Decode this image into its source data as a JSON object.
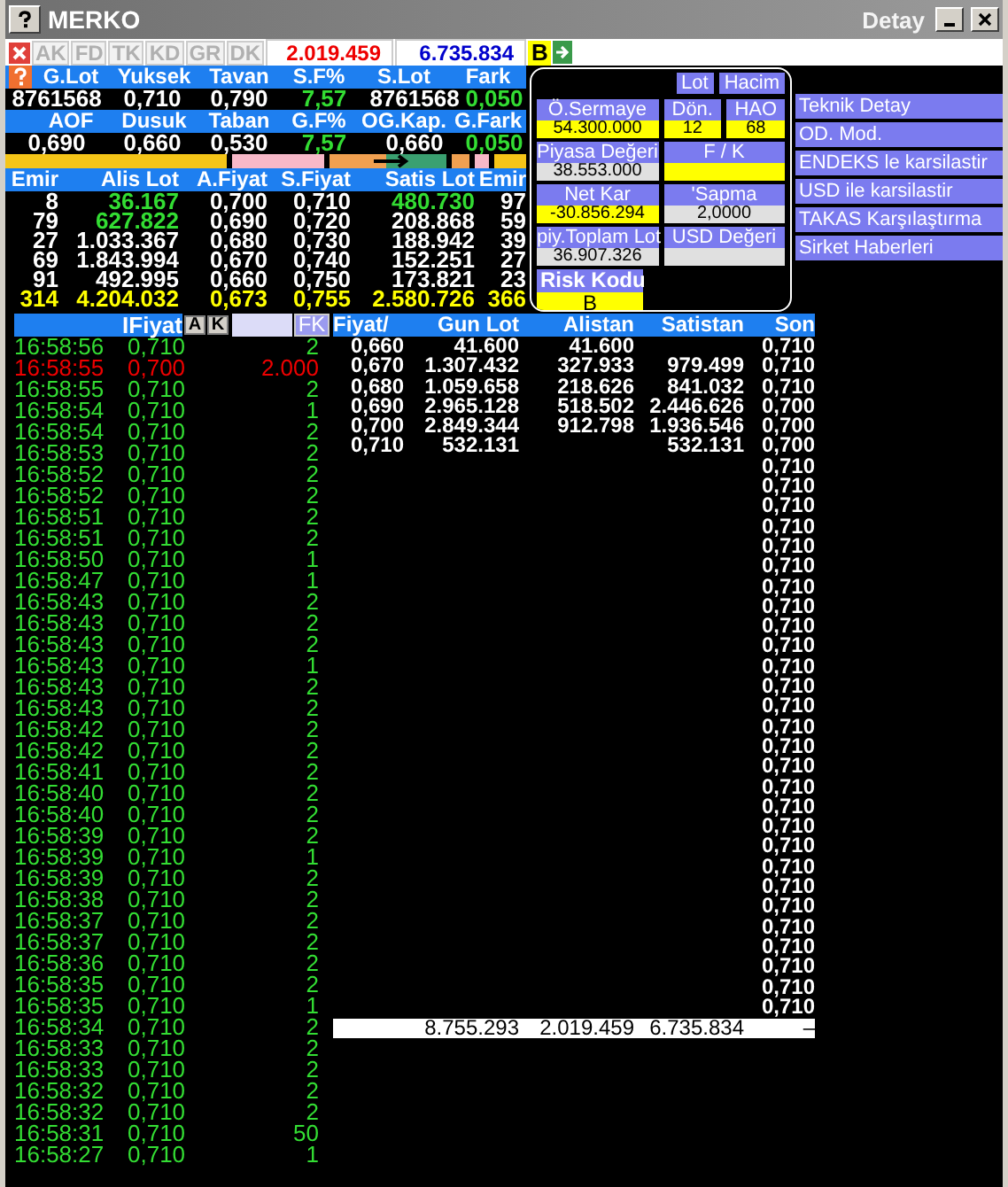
{
  "window": {
    "title": "MERKO",
    "subtitle": "Detay"
  },
  "toolbar": {
    "tabs": [
      {
        "label": "AK",
        "disabled": true
      },
      {
        "label": "FD",
        "disabled": true
      },
      {
        "label": "TK",
        "disabled": true
      },
      {
        "label": "KD",
        "disabled": true
      },
      {
        "label": "GR",
        "disabled": true
      },
      {
        "label": "DK",
        "disabled": true
      }
    ],
    "sell_total": "2.019.459",
    "buy_total": "6.735.834",
    "badge": "B"
  },
  "stats": [
    {
      "labels": [
        "G.Lot",
        "Yuksek",
        "Tavan",
        "S.F%",
        "S.Lot",
        "Fark"
      ],
      "values": [
        {
          "text": "8761568",
          "kind": "plain"
        },
        {
          "text": "0,710",
          "kind": "plain"
        },
        {
          "text": "0,790",
          "kind": "plain"
        },
        {
          "text": "7,57",
          "kind": "change"
        },
        {
          "text": "8761568",
          "kind": "plain"
        },
        {
          "text": "0,050",
          "kind": "change"
        }
      ]
    },
    {
      "labels": [
        "AOF",
        "Dusuk",
        "Taban",
        "G.F%",
        "OG.Kap.",
        "G.Fark"
      ],
      "values": [
        {
          "text": "0,690",
          "kind": "plain"
        },
        {
          "text": "0,660",
          "kind": "plain"
        },
        {
          "text": "0,530",
          "kind": "plain"
        },
        {
          "text": "7,57",
          "kind": "change"
        },
        {
          "text": "0,660",
          "kind": "plain"
        },
        {
          "text": "0,050",
          "kind": "change"
        }
      ]
    }
  ],
  "order_book": {
    "columns": [
      "Emir",
      "Alis Lot",
      "A.Fiyat",
      "S.Fiyat",
      "Satis Lot",
      "Emir"
    ],
    "rows": [
      {
        "kind": "level",
        "bid_orders": "8",
        "bid_lot": "36.167",
        "bid_lot_changed": true,
        "bid_price": "0,700",
        "ask_price": "0,710",
        "ask_lot": "480.730",
        "ask_lot_changed": true,
        "ask_orders": "97"
      },
      {
        "kind": "level",
        "bid_orders": "79",
        "bid_lot": "627.822",
        "bid_lot_changed": true,
        "bid_price": "0,690",
        "ask_price": "0,720",
        "ask_lot": "208.868",
        "ask_lot_changed": false,
        "ask_orders": "59"
      },
      {
        "kind": "level",
        "bid_orders": "27",
        "bid_lot": "1.033.367",
        "bid_lot_changed": false,
        "bid_price": "0,680",
        "ask_price": "0,730",
        "ask_lot": "188.942",
        "ask_lot_changed": false,
        "ask_orders": "39"
      },
      {
        "kind": "level",
        "bid_orders": "69",
        "bid_lot": "1.843.994",
        "bid_lot_changed": false,
        "bid_price": "0,670",
        "ask_price": "0,740",
        "ask_lot": "152.251",
        "ask_lot_changed": false,
        "ask_orders": "27"
      },
      {
        "kind": "level",
        "bid_orders": "91",
        "bid_lot": "492.995",
        "bid_lot_changed": false,
        "bid_price": "0,660",
        "ask_price": "0,750",
        "ask_lot": "173.821",
        "ask_lot_changed": false,
        "ask_orders": "23"
      },
      {
        "kind": "total",
        "bid_orders": "314",
        "bid_lot": "4.204.032",
        "bid_lot_changed": false,
        "bid_price": "0,673",
        "ask_price": "0,755",
        "ask_lot": "2.580.726",
        "ask_lot_changed": false,
        "ask_orders": "366"
      }
    ]
  },
  "info_panel": {
    "buttons": [
      "Lot",
      "Hacim"
    ],
    "rows": [
      {
        "cells": [
          {
            "label": "Ö.Sermaye",
            "value": "54.300.000",
            "highlighted": true
          },
          {
            "label": "Dön.",
            "value": "12",
            "highlighted": true
          },
          {
            "label": "HAO",
            "value": "68",
            "highlighted": true
          }
        ]
      },
      {
        "cells": [
          {
            "label": "Piyasa Değeri",
            "value": "38.553.000",
            "highlighted": false
          },
          {
            "label": "F / K",
            "highlighted": true
          }
        ]
      },
      {
        "cells": [
          {
            "label": "Net Kar",
            "value": "-30.856.294",
            "highlighted": true
          },
          {
            "label": "'Sapma",
            "value": "2,0000",
            "highlighted": false
          }
        ]
      },
      {
        "cells": [
          {
            "label": "piy.Toplam Lot",
            "value": "36.907.326",
            "highlighted": false
          },
          {
            "label": "USD Değeri",
            "highlighted": false
          }
        ]
      }
    ],
    "risk": {
      "label": "Risk Kodu",
      "value": "B"
    }
  },
  "menu": [
    "Teknik Detay",
    "OD. Mod.",
    "ENDEKS le karsilastir",
    "USD ile karsilastir",
    "TAKAS Karşılaştırma",
    "Sirket Haberleri"
  ],
  "trades": {
    "header": "IFiyat",
    "buttons": [
      "A",
      "K"
    ],
    "filter_button": "FK",
    "rows": [
      {
        "time": "16:58:56",
        "price": "0,710",
        "lot": "2",
        "kind": "up"
      },
      {
        "time": "16:58:55",
        "price": "0,700",
        "lot": "2.000",
        "kind": "down"
      },
      {
        "time": "16:58:55",
        "price": "0,710",
        "lot": "2",
        "kind": "up"
      },
      {
        "time": "16:58:54",
        "price": "0,710",
        "lot": "1",
        "kind": "up"
      },
      {
        "time": "16:58:54",
        "price": "0,710",
        "lot": "2",
        "kind": "up"
      },
      {
        "time": "16:58:53",
        "price": "0,710",
        "lot": "2",
        "kind": "up"
      },
      {
        "time": "16:58:52",
        "price": "0,710",
        "lot": "2",
        "kind": "up"
      },
      {
        "time": "16:58:52",
        "price": "0,710",
        "lot": "2",
        "kind": "up"
      },
      {
        "time": "16:58:51",
        "price": "0,710",
        "lot": "2",
        "kind": "up"
      },
      {
        "time": "16:58:51",
        "price": "0,710",
        "lot": "2",
        "kind": "up"
      },
      {
        "time": "16:58:50",
        "price": "0,710",
        "lot": "1",
        "kind": "up"
      },
      {
        "time": "16:58:47",
        "price": "0,710",
        "lot": "1",
        "kind": "up"
      },
      {
        "time": "16:58:43",
        "price": "0,710",
        "lot": "2",
        "kind": "up"
      },
      {
        "time": "16:58:43",
        "price": "0,710",
        "lot": "2",
        "kind": "up"
      },
      {
        "time": "16:58:43",
        "price": "0,710",
        "lot": "2",
        "kind": "up"
      },
      {
        "time": "16:58:43",
        "price": "0,710",
        "lot": "1",
        "kind": "up"
      },
      {
        "time": "16:58:43",
        "price": "0,710",
        "lot": "2",
        "kind": "up"
      },
      {
        "time": "16:58:43",
        "price": "0,710",
        "lot": "2",
        "kind": "up"
      },
      {
        "time": "16:58:42",
        "price": "0,710",
        "lot": "2",
        "kind": "up"
      },
      {
        "time": "16:58:42",
        "price": "0,710",
        "lot": "2",
        "kind": "up"
      },
      {
        "time": "16:58:41",
        "price": "0,710",
        "lot": "2",
        "kind": "up"
      },
      {
        "time": "16:58:40",
        "price": "0,710",
        "lot": "2",
        "kind": "up"
      },
      {
        "time": "16:58:40",
        "price": "0,710",
        "lot": "2",
        "kind": "up"
      },
      {
        "time": "16:58:39",
        "price": "0,710",
        "lot": "2",
        "kind": "up"
      },
      {
        "time": "16:58:39",
        "price": "0,710",
        "lot": "1",
        "kind": "up"
      },
      {
        "time": "16:58:39",
        "price": "0,710",
        "lot": "2",
        "kind": "up"
      },
      {
        "time": "16:58:38",
        "price": "0,710",
        "lot": "2",
        "kind": "up"
      },
      {
        "time": "16:58:37",
        "price": "0,710",
        "lot": "2",
        "kind": "up"
      },
      {
        "time": "16:58:37",
        "price": "0,710",
        "lot": "2",
        "kind": "up"
      },
      {
        "time": "16:58:36",
        "price": "0,710",
        "lot": "2",
        "kind": "up"
      },
      {
        "time": "16:58:35",
        "price": "0,710",
        "lot": "2",
        "kind": "up"
      },
      {
        "time": "16:58:35",
        "price": "0,710",
        "lot": "1",
        "kind": "up"
      },
      {
        "time": "16:58:34",
        "price": "0,710",
        "lot": "2",
        "kind": "up"
      },
      {
        "time": "16:58:33",
        "price": "0,710",
        "lot": "2",
        "kind": "up"
      },
      {
        "time": "16:58:33",
        "price": "0,710",
        "lot": "2",
        "kind": "up"
      },
      {
        "time": "16:58:32",
        "price": "0,710",
        "lot": "2",
        "kind": "up"
      },
      {
        "time": "16:58:32",
        "price": "0,710",
        "lot": "2",
        "kind": "up"
      },
      {
        "time": "16:58:31",
        "price": "0,710",
        "lot": "50",
        "kind": "up"
      },
      {
        "time": "16:58:27",
        "price": "0,710",
        "lot": "1",
        "kind": "up"
      }
    ]
  },
  "price_table": {
    "columns": [
      "Fiyat/",
      "Gun Lot",
      "Alistan",
      "Satistan",
      "Son"
    ],
    "rows": [
      {
        "price": "0,660",
        "day_lot": "41.600",
        "bought": "41.600"
      },
      {
        "price": "0,670",
        "day_lot": "1.307.432",
        "bought": "327.933",
        "sold": "979.499"
      },
      {
        "price": "0,680",
        "day_lot": "1.059.658",
        "bought": "218.626",
        "sold": "841.032"
      },
      {
        "price": "0,690",
        "day_lot": "2.965.128",
        "bought": "518.502",
        "sold": "2.446.626"
      },
      {
        "price": "0,700",
        "day_lot": "2.849.344",
        "bought": "912.798",
        "sold": "1.936.546"
      },
      {
        "price": "0,710",
        "day_lot": "532.131",
        "sold": "532.131"
      }
    ],
    "last_prices": [
      "0,710",
      "0,710",
      "0,710",
      "0,700",
      "0,700",
      "0,700",
      "0,710",
      "0,710",
      "0,710",
      "0,710",
      "0,710",
      "0,710",
      "0,710",
      "0,710",
      "0,710",
      "0,710",
      "0,710",
      "0,710",
      "0,710",
      "0,710",
      "0,710",
      "0,710",
      "0,710",
      "0,710",
      "0,710",
      "0,710",
      "0,710",
      "0,710",
      "0,710",
      "0,710",
      "0,710",
      "0,710",
      "0,710",
      "0,710"
    ],
    "totals": {
      "day_lot": "8.755.293",
      "bought": "2.019.459",
      "sold": "6.735.834",
      "last": "–"
    }
  }
}
